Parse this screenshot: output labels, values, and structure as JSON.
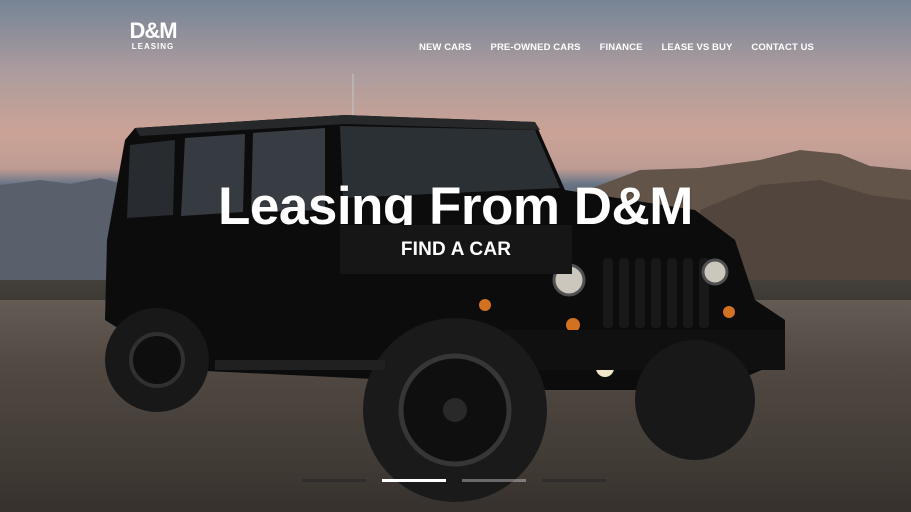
{
  "brand": {
    "logo_mark": "D&M",
    "logo_sub": "LEASING"
  },
  "nav": {
    "items": [
      {
        "label": "NEW CARS"
      },
      {
        "label": "PRE-OWNED CARS"
      },
      {
        "label": "FINANCE"
      },
      {
        "label": "LEASE VS BUY"
      },
      {
        "label": "CONTACT US"
      }
    ]
  },
  "hero": {
    "headline": "Leasing From D&M",
    "cta_label": "FIND A CAR",
    "slides_total": 4,
    "active_slide": 2
  },
  "colors": {
    "cta_bg": "#161616",
    "text": "#ffffff"
  }
}
